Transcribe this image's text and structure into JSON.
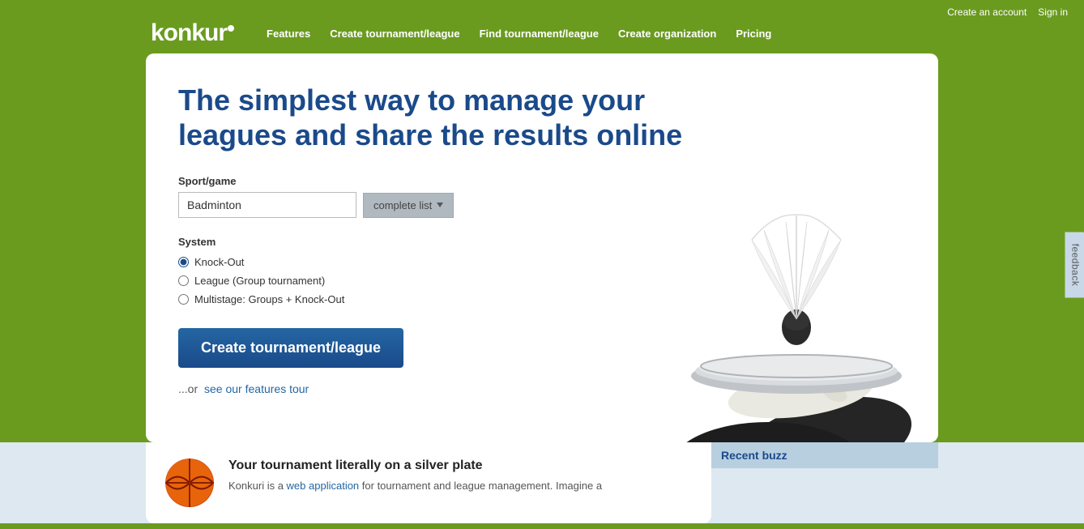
{
  "header": {
    "create_account": "Create an account",
    "sign_in": "Sign in",
    "logo": "konkuri",
    "nav": {
      "features": "Features",
      "create_tournament": "Create tournament/league",
      "find_tournament": "Find tournament/league",
      "create_org": "Create organization",
      "pricing": "Pricing"
    }
  },
  "hero": {
    "title": "The simplest way to manage your leagues and share the results online"
  },
  "form": {
    "sport_label": "Sport/game",
    "sport_value": "Badminton",
    "complete_list_btn": "complete list",
    "system_label": "System",
    "radio_options": [
      {
        "id": "ko",
        "label": "Knock-Out",
        "checked": true
      },
      {
        "id": "league",
        "label": "League (Group tournament)",
        "checked": false
      },
      {
        "id": "multi",
        "label": "Multistage: Groups + Knock-Out",
        "checked": false
      }
    ],
    "create_btn": "Create tournament/league",
    "or_text": "...or",
    "features_link": "see our features tour"
  },
  "bottom": {
    "title": "Your tournament literally on a silver plate",
    "description": "Konkuri is a web application for tournament and league management. Imagine a",
    "description_link": "web application",
    "recent_buzz_title": "Recent buzz"
  },
  "feedback": {
    "label": "feedback"
  }
}
